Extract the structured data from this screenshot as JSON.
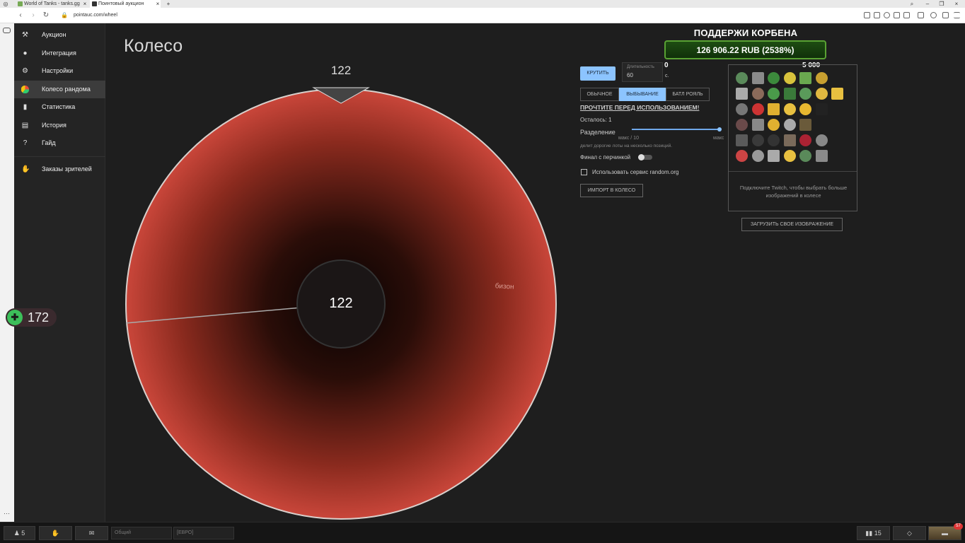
{
  "browser": {
    "tabs": [
      "World of Tanks - tanks.gg",
      "Поинтовый аукцион"
    ],
    "url": "pointauc.com/wheel"
  },
  "sidebar": {
    "items": [
      {
        "label": "Аукцион",
        "icon": "gavel-icon"
      },
      {
        "label": "Интеграция",
        "icon": "user-circle-icon"
      },
      {
        "label": "Настройки",
        "icon": "gear-icon"
      },
      {
        "label": "Колесо рандома",
        "icon": "pie-chart-icon"
      },
      {
        "label": "Статистика",
        "icon": "bar-chart-icon"
      },
      {
        "label": "История",
        "icon": "clipboard-icon"
      },
      {
        "label": "Гайд",
        "icon": "help-icon"
      }
    ],
    "extra": {
      "label": "Заказы зрителей",
      "icon": "hand-icon"
    }
  },
  "main": {
    "title": "Колесо",
    "pointer_value": "122",
    "center_value": "122",
    "segment_label": "бизон",
    "colors": {
      "wheel": "#c0392b",
      "bg": "#222222"
    }
  },
  "controls": {
    "spin_button": "КРУТИТЬ",
    "duration_label": "Длительность",
    "duration_value": "60",
    "duration_unit": "с.",
    "mode_tabs": [
      "ОБЫЧНОЕ",
      "ВЫБЫВАНИЕ",
      "БАТЛ РОЯЛЬ"
    ],
    "read_link": "ПРОЧТИТЕ ПЕРЕД ИСПОЛЬЗОВАНИЕМ!",
    "remaining": "Осталось: 1",
    "split_label": "Разделение",
    "split_value": "макс / 10",
    "split_max": "макс",
    "split_hint": "делит дорогие лоты на несколько позиций.",
    "final_label": "Финал с перчинкой",
    "random_org_label": "Использовать сервис random.org",
    "import_button": "ИМПОРТ В КОЛЕСО"
  },
  "overlay": {
    "donate_title": "ПОДДЕРЖИ КОРБЕНА",
    "donate_amount": "126 906.22 RUB (2538%)",
    "counter_small": "0",
    "counter_big": "5 000"
  },
  "image_panel": {
    "twitch_hint": "Подключите Twitch, чтобы выбрать больше изображений в колесе",
    "upload_button": "ЗАГРУЗИТЬ СВОЕ ИЗОБРАЖЕНИЕ"
  },
  "game_bar": {
    "players": "5",
    "chat_general": "Общий",
    "chat_region": "[ЕВРО]",
    "online": "15",
    "badge": "57"
  },
  "side_badge": {
    "value": "172"
  }
}
